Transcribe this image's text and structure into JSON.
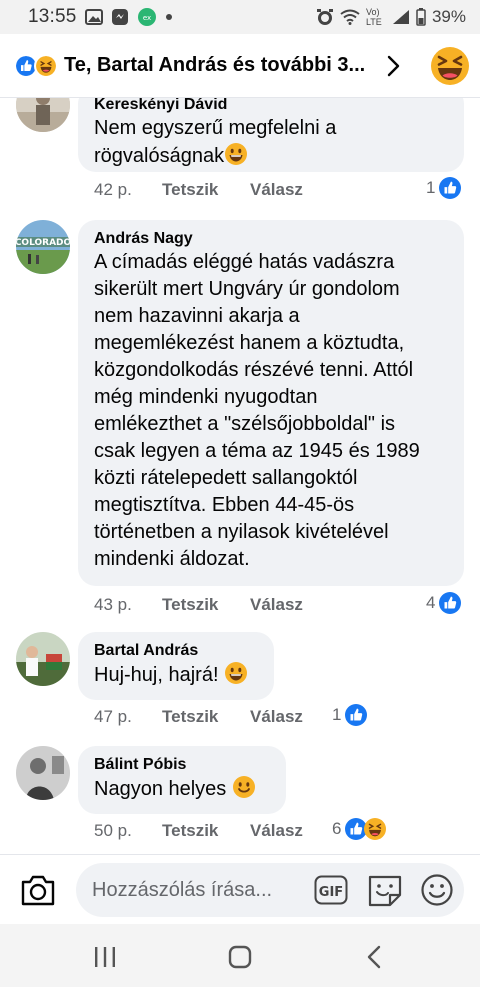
{
  "status_bar": {
    "time": "13:55",
    "network": "Vo) LTE",
    "battery": "39%"
  },
  "header": {
    "title": "Te, Bartal András és további 3...",
    "reaction_icons": [
      "like-icon",
      "laughing-icon"
    ],
    "right_icon": "haha-emoji-icon"
  },
  "comments": [
    {
      "author": "Kereskényi Dávid",
      "lines": [
        "Nem egyszerű megfelelni a",
        "rögvalóságnak"
      ],
      "emoji": "grinning-emoji",
      "time": "42 p.",
      "like_label": "Tetszik",
      "reply_label": "Válasz",
      "reaction_count": "1",
      "reactions": [
        "like-icon"
      ]
    },
    {
      "author": "András Nagy",
      "lines": [
        "A címadás eléggé hatás vadászra",
        "sikerült mert Ungváry úr gondolom",
        "nem hazavinni akarja a",
        "megemlékezést hanem a köztudta,",
        "közgondolkodás részévé tenni. Attól",
        "még mindenki nyugodtan",
        "emlékezthet a \"szélsőjobboldal\" is",
        "csak legyen a téma az 1945 és 1989",
        "közti rátelepedett sallangoktól",
        "megtisztítva. Ebben 44-45-ös",
        "történetben a nyilasok kivételével",
        "mindenki áldozat."
      ],
      "time": "43 p.",
      "like_label": "Tetszik",
      "reply_label": "Válasz",
      "reaction_count": "4",
      "reactions": [
        "like-icon"
      ],
      "avatar_text": "COLORADO"
    },
    {
      "author": "Bartal András",
      "lines": [
        "Huj-huj, hajrá!"
      ],
      "emoji": "grinning-emoji",
      "time": "47 p.",
      "like_label": "Tetszik",
      "reply_label": "Válasz",
      "reaction_count": "1",
      "reactions": [
        "like-icon"
      ]
    },
    {
      "author": "Bálint Póbis",
      "lines": [
        "Nagyon helyes"
      ],
      "emoji": "smiling-emoji",
      "time": "50 p.",
      "like_label": "Tetszik",
      "reply_label": "Válasz",
      "reaction_count": "6",
      "reactions": [
        "like-icon",
        "laughing-icon"
      ]
    }
  ],
  "composer": {
    "placeholder": "Hozzászólás írása...",
    "gif_label": "GIF"
  },
  "colors": {
    "facebook_blue": "#1877f2",
    "bubble_bg": "#f0f2f5",
    "secondary_text": "#65676b",
    "emoji_yellow": "#f7b125"
  }
}
